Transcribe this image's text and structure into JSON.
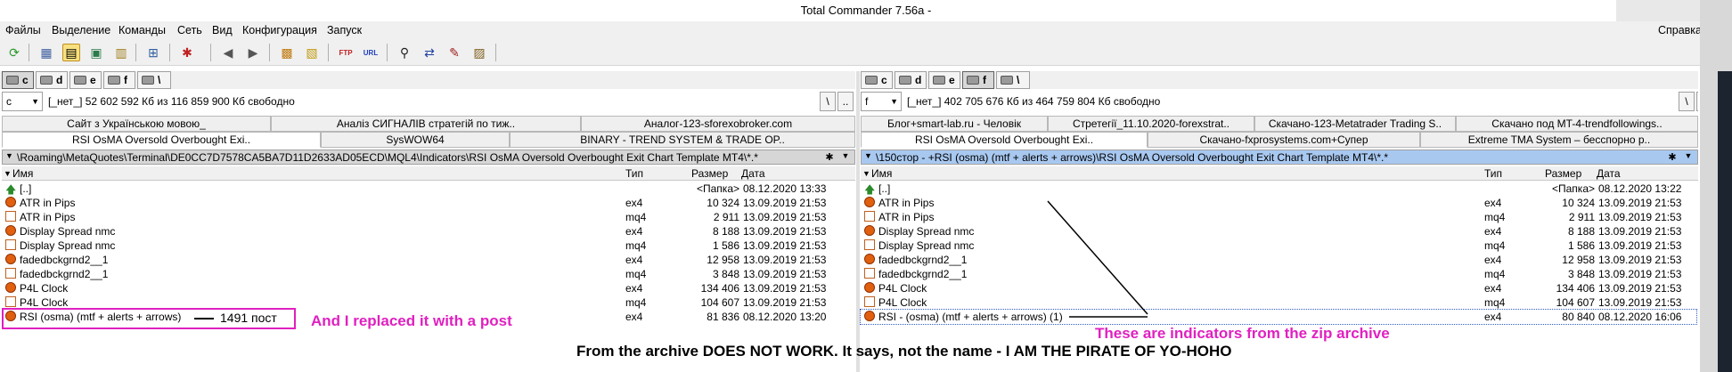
{
  "window": {
    "title": "Total Commander 7.56a -"
  },
  "menu": {
    "items": [
      "Файлы",
      "Выделение",
      "Команды",
      "Сеть",
      "Вид",
      "Конфигурация",
      "Запуск"
    ],
    "help": "Справка"
  },
  "toolbar": {
    "icons": [
      "refresh-icon",
      "brief-view-icon",
      "detailed-view-icon",
      "thumbnail-view-icon",
      "tree-view-icon",
      "invert-selection-icon",
      "select-group-icon",
      "back-icon",
      "forward-icon",
      "pack-icon",
      "unpack-icon",
      "ftp-icon",
      "url-icon",
      "find-icon",
      "sync-dirs-icon",
      "multi-rename-icon",
      "compare-icon"
    ]
  },
  "left": {
    "drives": [
      "c",
      "d",
      "e",
      "f",
      "\\"
    ],
    "active_drive": "c",
    "drive_select": "c",
    "free_space_text": "[_нет_]  52 602 592 Кб из 116 859 900 Кб свободно",
    "tabs_row1": [
      "Сайт з Українською мовою_",
      "Аналіз СИГНАЛІВ стратегій по тиж..",
      "Аналог-123-sforexobroker.com"
    ],
    "tabs_row2": [
      "RSI OsMA Oversold Overbought Exi..",
      "SysWOW64",
      "BINARY - TREND SYSTEM & TRADE OP.."
    ],
    "path": "\\Roaming\\MetaQuotes\\Terminal\\DE0CC7D7578CA5BA7D11D2633AD05ECD\\MQL4\\Indicators\\RSI OsMA Oversold Overbought Exit Chart Template MT4\\*.*",
    "columns": {
      "name": "Имя",
      "type": "Тип",
      "size": "Размер",
      "date": "Дата"
    },
    "files": [
      {
        "name": "[..]",
        "type": "",
        "size": "<Папка>",
        "date": "08.12.2020 13:33",
        "kind": "up"
      },
      {
        "name": "ATR in Pips",
        "type": "ex4",
        "size": "10 324",
        "date": "13.09.2019 21:53",
        "kind": "ex4"
      },
      {
        "name": "ATR in Pips",
        "type": "mq4",
        "size": "2 911",
        "date": "13.09.2019 21:53",
        "kind": "mq4"
      },
      {
        "name": "Display Spread nmc",
        "type": "ex4",
        "size": "8 188",
        "date": "13.09.2019 21:53",
        "kind": "ex4"
      },
      {
        "name": "Display Spread nmc",
        "type": "mq4",
        "size": "1 586",
        "date": "13.09.2019 21:53",
        "kind": "mq4"
      },
      {
        "name": "fadedbckgrnd2__1",
        "type": "ex4",
        "size": "12 958",
        "date": "13.09.2019 21:53",
        "kind": "ex4"
      },
      {
        "name": "fadedbckgrnd2__1",
        "type": "mq4",
        "size": "3 848",
        "date": "13.09.2019 21:53",
        "kind": "mq4"
      },
      {
        "name": "P4L Clock",
        "type": "ex4",
        "size": "134 406",
        "date": "13.09.2019 21:53",
        "kind": "ex4"
      },
      {
        "name": "P4L Clock",
        "type": "mq4",
        "size": "104 607",
        "date": "13.09.2019 21:53",
        "kind": "mq4"
      },
      {
        "name": "RSI (osma) (mtf + alerts + arrows)",
        "type": "ex4",
        "size": "81 836",
        "date": "08.12.2020 13:20",
        "kind": "ex4"
      }
    ]
  },
  "right": {
    "drives": [
      "c",
      "d",
      "e",
      "f",
      "\\"
    ],
    "active_drive": "f",
    "drive_select": "f",
    "free_space_text": "[_нет_]  402 705 676 Кб из 464 759 804 Кб свободно",
    "tabs_row1": [
      "Блог+smart-lab.ru - Человік",
      "Стретегії_11.10.2020-forexstrat..",
      "Скачано-123-Metatrader Trading S..",
      "Скачано под MT-4-trendfollowings.."
    ],
    "tabs_row2": [
      "RSI OsMA Oversold Overbought Exi..",
      "Скачано-fxprosystems.com+Супер",
      "Extreme TMA System – бесспорно р.."
    ],
    "path": "\\150стор - +RSI (osma) (mtf + alerts + arrows)\\RSI OsMA Oversold Overbought Exit Chart Template MT4\\*.*",
    "columns": {
      "name": "Имя",
      "type": "Тип",
      "size": "Размер",
      "date": "Дата"
    },
    "files": [
      {
        "name": "[..]",
        "type": "",
        "size": "<Папка>",
        "date": "08.12.2020 13:22",
        "kind": "up"
      },
      {
        "name": "ATR in Pips",
        "type": "ex4",
        "size": "10 324",
        "date": "13.09.2019 21:53",
        "kind": "ex4"
      },
      {
        "name": "ATR in Pips",
        "type": "mq4",
        "size": "2 911",
        "date": "13.09.2019 21:53",
        "kind": "mq4"
      },
      {
        "name": "Display Spread nmc",
        "type": "ex4",
        "size": "8 188",
        "date": "13.09.2019 21:53",
        "kind": "ex4"
      },
      {
        "name": "Display Spread nmc",
        "type": "mq4",
        "size": "1 586",
        "date": "13.09.2019 21:53",
        "kind": "mq4"
      },
      {
        "name": "fadedbckgrnd2__1",
        "type": "ex4",
        "size": "12 958",
        "date": "13.09.2019 21:53",
        "kind": "ex4"
      },
      {
        "name": "fadedbckgrnd2__1",
        "type": "mq4",
        "size": "3 848",
        "date": "13.09.2019 21:53",
        "kind": "mq4"
      },
      {
        "name": "P4L Clock",
        "type": "ex4",
        "size": "134 406",
        "date": "13.09.2019 21:53",
        "kind": "ex4"
      },
      {
        "name": "P4L Clock",
        "type": "mq4",
        "size": "104 607",
        "date": "13.09.2019 21:53",
        "kind": "mq4"
      },
      {
        "name": "RSI - (osma) (mtf + alerts + arrows) (1)",
        "type": "ex4",
        "size": "80 840",
        "date": "08.12.2020 16:06",
        "kind": "ex4"
      }
    ]
  },
  "annotations": {
    "post_label": "1491 пост",
    "replaced_note": "And I replaced it with a post",
    "zip_note": "These are indicators from the zip archive",
    "bottom_note": "From the archive DOES NOT WORK. It says, not the name - I AM THE PIRATE OF YO-HOHO"
  },
  "colors": {
    "annotation": "#e020c0",
    "active_path": "#a8c8f0"
  }
}
